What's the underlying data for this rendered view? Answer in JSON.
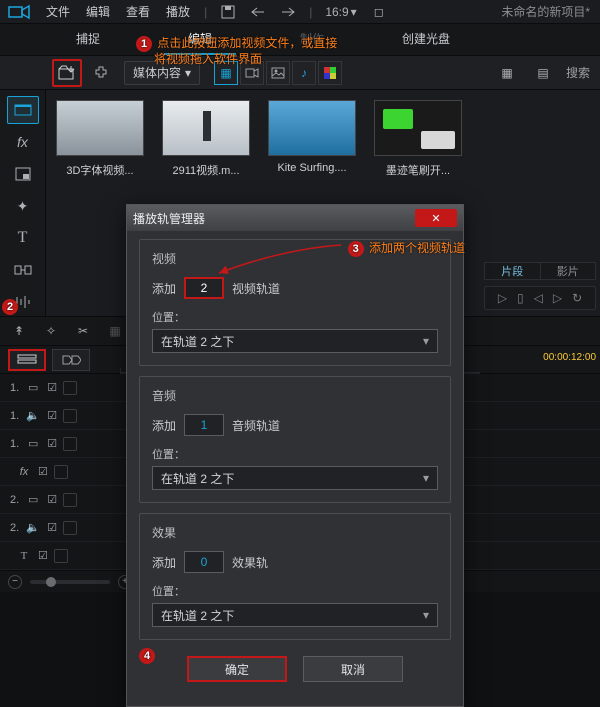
{
  "menubar": {
    "items": [
      "文件",
      "编辑",
      "查看",
      "播放"
    ],
    "aspect": "16:9",
    "project_title": "未命名的新项目*"
  },
  "tabs": {
    "items": [
      "捕捉",
      "编辑",
      "制作",
      "创建光盘"
    ],
    "active_index": 1
  },
  "toolbar": {
    "media_dropdown": "媒体内容",
    "search_label": "搜索"
  },
  "callouts": {
    "c1": {
      "num": "1",
      "line1": "点击此按钮添加视频文件，或直接",
      "line2": "将视频拖入软件界面"
    },
    "c2": {
      "num": "2"
    },
    "c3": {
      "num": "3",
      "text": "添加两个视频轨道"
    },
    "c4": {
      "num": "4"
    }
  },
  "media": {
    "items": [
      {
        "caption": "3D字体视频..."
      },
      {
        "caption": "2911视频.m..."
      },
      {
        "caption": "Kite Surfing...."
      },
      {
        "caption": "墨迹笔刷开..."
      }
    ]
  },
  "preview": {
    "seg_a": "片段",
    "seg_b": "影片"
  },
  "timeline": {
    "timecode_a": "00:00:12:00",
    "tracks": [
      {
        "idx": "1.",
        "type": "video"
      },
      {
        "idx": "1.",
        "type": "audio"
      },
      {
        "idx": "1.",
        "type": "empty"
      },
      {
        "idx": "",
        "type": "fx",
        "label": "fx"
      },
      {
        "idx": "2.",
        "type": "video"
      },
      {
        "idx": "2.",
        "type": "audio"
      },
      {
        "idx": "",
        "type": "title",
        "label": "T"
      }
    ]
  },
  "dialog": {
    "title": "播放轨管理器",
    "video": {
      "heading": "视频",
      "add_prefix": "添加",
      "value": "2",
      "add_suffix": "视频轨道",
      "pos_label": "位置：",
      "pos_value": "在轨道 2 之下"
    },
    "audio": {
      "heading": "音频",
      "add_prefix": "添加",
      "value": "1",
      "add_suffix": "音频轨道",
      "pos_label": "位置：",
      "pos_value": "在轨道 2 之下"
    },
    "fx": {
      "heading": "效果",
      "add_prefix": "添加",
      "value": "0",
      "add_suffix": "效果轨",
      "pos_label": "位置：",
      "pos_value": "在轨道 2 之下"
    },
    "ok": "确定",
    "cancel": "取消"
  }
}
